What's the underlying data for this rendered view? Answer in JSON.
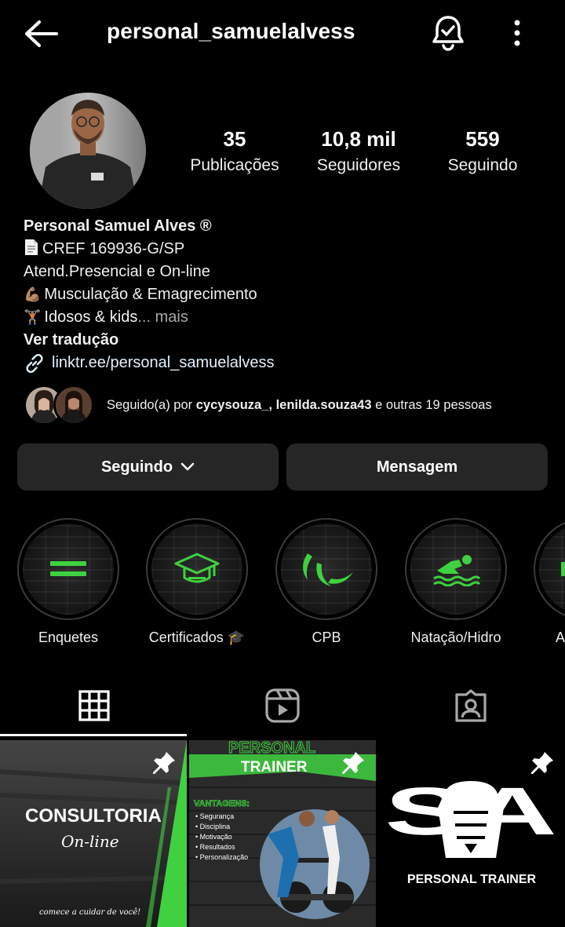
{
  "header": {
    "username": "personal_samuelalvess"
  },
  "stats": [
    {
      "value": "35",
      "label": "Publicações"
    },
    {
      "value": "10,8 mil",
      "label": "Seguidores"
    },
    {
      "value": "559",
      "label": "Seguindo"
    }
  ],
  "bio": {
    "name": "Personal Samuel Alves ®",
    "line1": "CREF 169936-G/SP",
    "line2": "Atend.Presencial e On-line",
    "line3_emoji": "💪🏽",
    "line3": "Musculação & Emagrecimento",
    "line4_emoji": "🏋🏽",
    "line4": "Idosos & kids",
    "more": "... mais",
    "translate": "Ver tradução",
    "link": "linktr.ee/personal_samuelalvess"
  },
  "followed_by": {
    "prefix": "Seguido(a) por ",
    "user1": "cycysouza_",
    "sep": ", ",
    "user2": "lenilda.souza43",
    "suffix": " e outras 19 pessoas"
  },
  "buttons": {
    "following": "Seguindo",
    "message": "Mensagem"
  },
  "highlights": [
    {
      "label": "Enquetes",
      "icon": "equals-icon"
    },
    {
      "label": "Certificados 🎓",
      "icon": "graduation-cap-icon"
    },
    {
      "label": "CPB",
      "icon": "paralympic-agitos-icon"
    },
    {
      "label": "Natação/Hidro",
      "icon": "swimmer-icon"
    },
    {
      "label": "A",
      "icon": "weightlifting-icon"
    }
  ],
  "tabs": [
    {
      "name": "grid-icon"
    },
    {
      "name": "reels-icon"
    },
    {
      "name": "tagged-icon"
    }
  ],
  "posts": {
    "p1": {
      "title": "CONSULTORIA",
      "subtitle": "On-line",
      "footer": "comece a cuidar de você!"
    },
    "p2": {
      "top": "PERSONAL",
      "title": "TRAINER",
      "heading": "VANTAGENS:",
      "items": [
        "• Segurança",
        "• Disciplina",
        "• Motivação",
        "• Resultados",
        "• Personalização"
      ]
    },
    "p3": {
      "logo": "SA",
      "caption": "PERSONAL TRAINER"
    }
  },
  "colors": {
    "accent_green": "#3fd13f",
    "button_bg": "#262626",
    "background": "#000000"
  }
}
